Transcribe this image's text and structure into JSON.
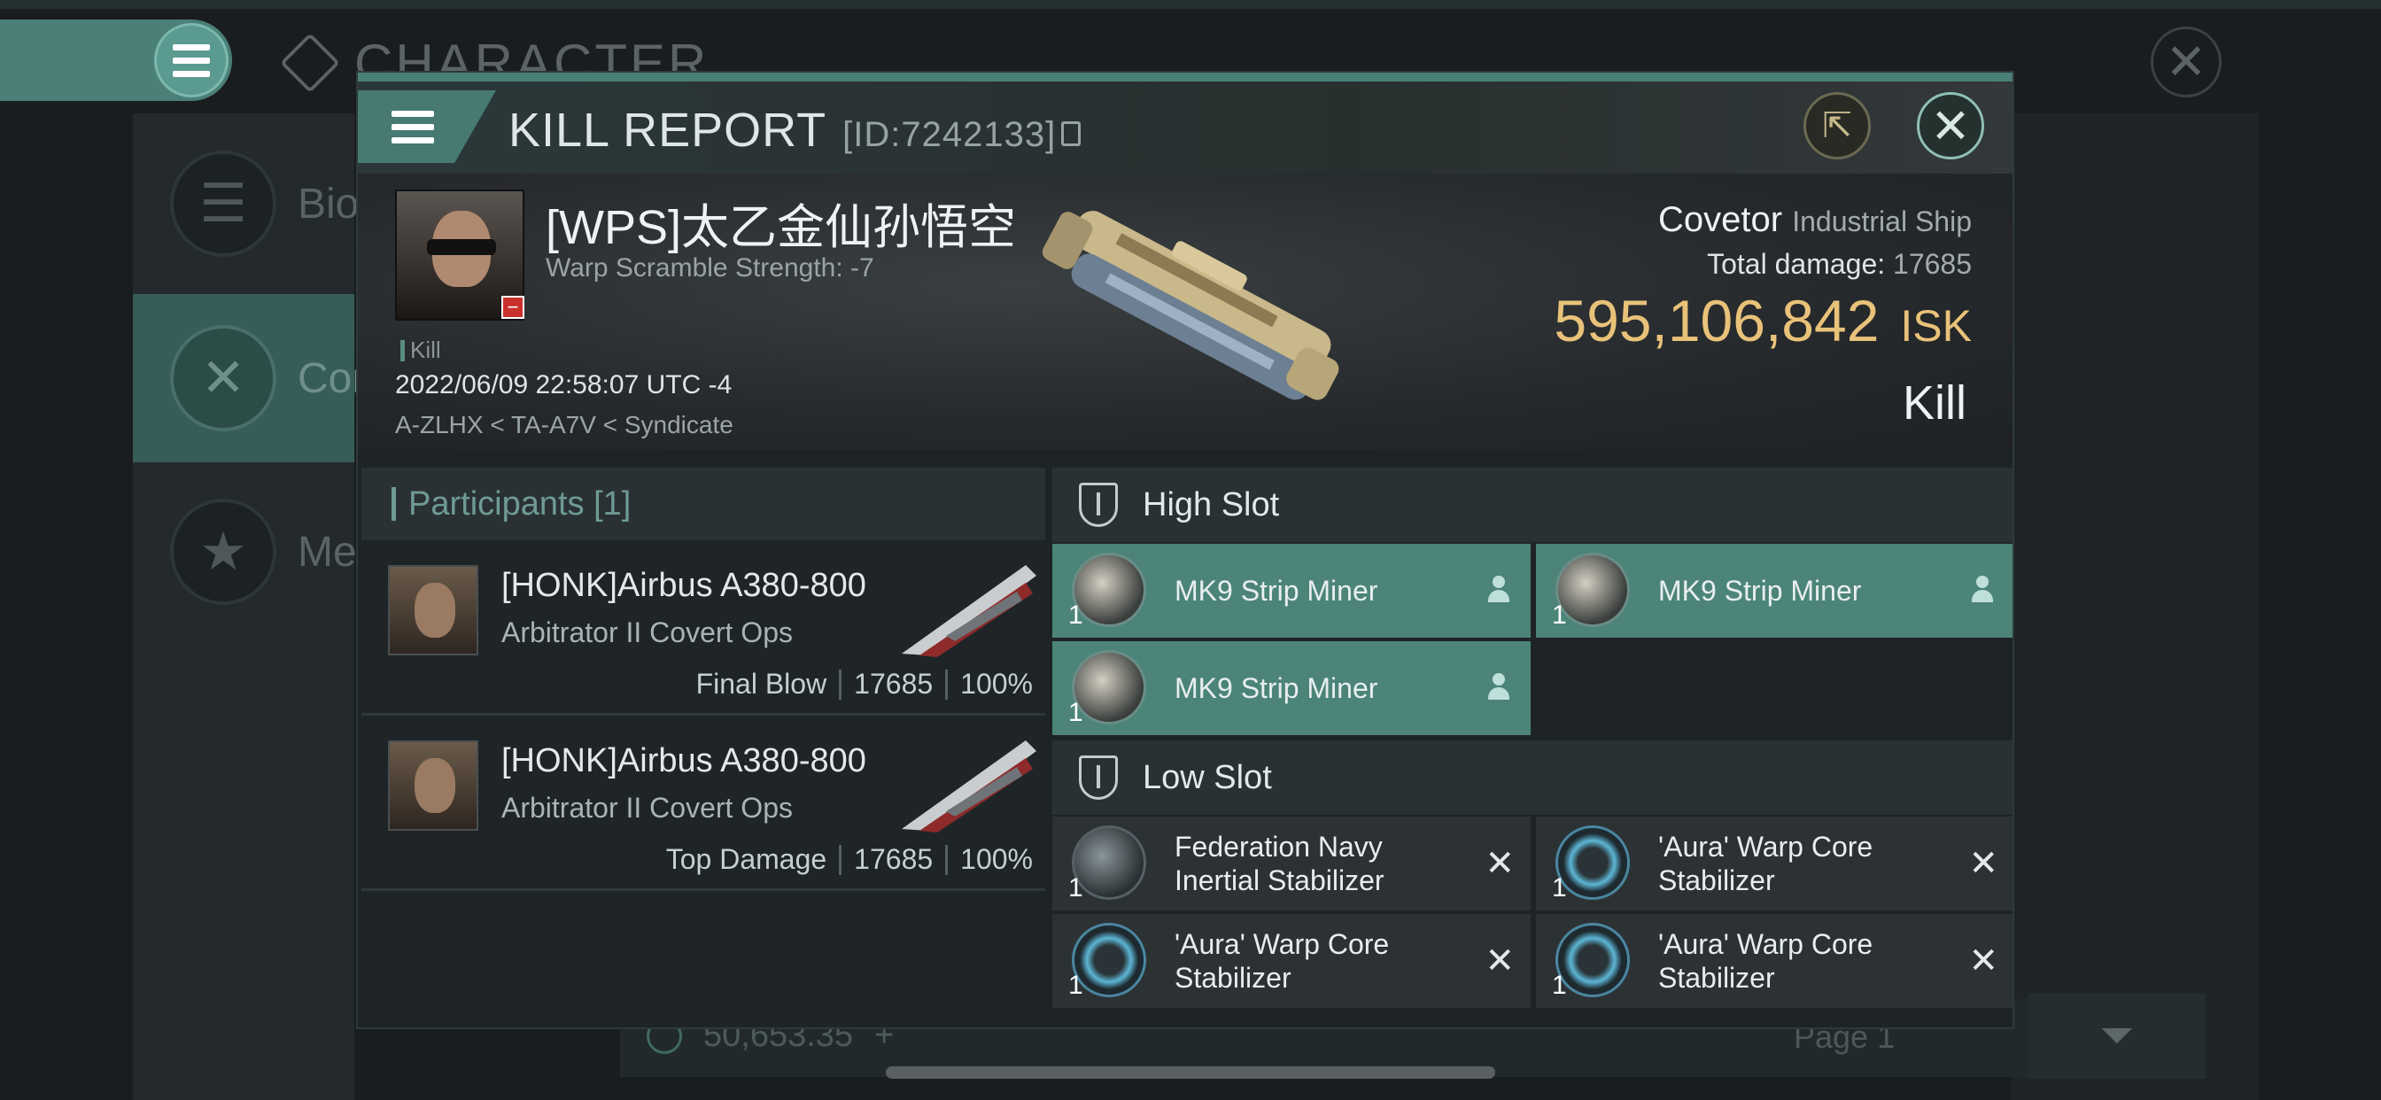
{
  "background": {
    "section_title": "CHARACTER",
    "sidebar": [
      {
        "label": "Bio",
        "icon": "list-icon"
      },
      {
        "label": "Com",
        "icon": "crossed-swords-icon"
      },
      {
        "label": "Med",
        "icon": "star-badge-icon"
      }
    ],
    "balance": "50,653.35",
    "page_label": "Page 1"
  },
  "modal": {
    "title": "KILL REPORT",
    "id_label": "[ID:7242133]",
    "victim": {
      "name": "[WPS]太乙金仙孙悟空",
      "warp_scramble": "Warp Scramble Strength: -7",
      "tag": "Kill",
      "timestamp": "2022/06/09 22:58:07 UTC -4",
      "location": "A-ZLHX < TA-A7V < Syndicate"
    },
    "ship": {
      "name": "Covetor",
      "class": "Industrial Ship",
      "total_damage_label": "Total damage:",
      "total_damage": "17685",
      "isk_value": "595,106,842",
      "isk_unit": "ISK",
      "result": "Kill"
    },
    "participants": {
      "header": "Participants [1]",
      "rows": [
        {
          "name": "[HONK]Airbus A380-800",
          "ship": "Arbitrator II Covert Ops",
          "role": "Final Blow",
          "damage": "17685",
          "percent": "100%"
        },
        {
          "name": "[HONK]Airbus A380-800",
          "ship": "Arbitrator II Covert Ops",
          "role": "Top Damage",
          "damage": "17685",
          "percent": "100%"
        }
      ]
    },
    "high_slot": {
      "label": "High Slot",
      "modules": [
        {
          "name": "MK9 Strip Miner",
          "qty": "1"
        },
        {
          "name": "MK9 Strip Miner",
          "qty": "1"
        },
        {
          "name": "MK9 Strip Miner",
          "qty": "1"
        }
      ]
    },
    "low_slot": {
      "label": "Low Slot",
      "modules": [
        {
          "name": "Federation Navy Inertial Stabilizer",
          "qty": "1"
        },
        {
          "name": "'Aura' Warp Core Stabilizer",
          "qty": "1"
        },
        {
          "name": "'Aura' Warp Core Stabilizer",
          "qty": "1"
        },
        {
          "name": "'Aura' Warp Core Stabilizer",
          "qty": "1"
        }
      ]
    }
  },
  "colors": {
    "accent": "#4a8078",
    "isk": "#e9c27a",
    "fitted_module": "#4c8479"
  }
}
